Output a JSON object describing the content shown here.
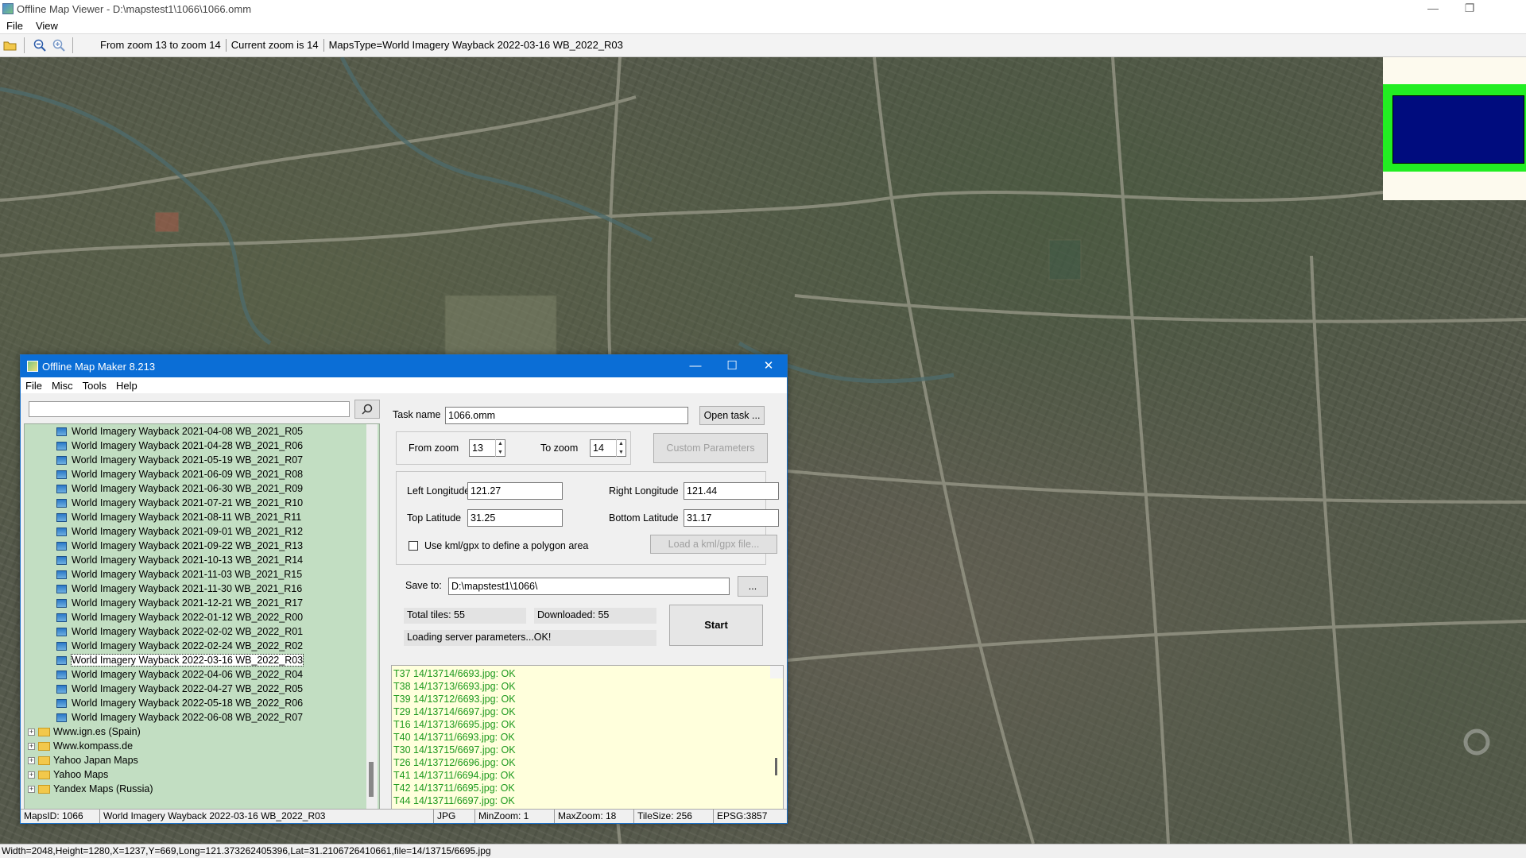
{
  "app": {
    "title": "Offline Map Viewer - D:\\mapstest1\\1066\\1066.omm",
    "minimize": "—",
    "restore": "❐",
    "menu": [
      "File",
      "View"
    ]
  },
  "toolbar": {
    "zoom_range": "From zoom 13 to zoom 14",
    "current_zoom": "Current zoom is 14",
    "maps_type": "MapsType=World Imagery Wayback 2022-03-16 WB_2022_R03"
  },
  "status_bar": "Width=2048,Height=1280,X=1237,Y=669,Long=121.373262405396,Lat=31.2106726410661,file=14/13715/6695.jpg",
  "colors": {
    "overview_bg": "#fdfaee",
    "overview_frame": "#22ee22",
    "overview_view": "#000c7e",
    "dialog_title": "#0b6ed6",
    "tree_bg": "#c2dec2",
    "log_bg": "#ffffdc",
    "log_text": "#1e9a1e"
  },
  "dialog": {
    "title": "Offline Map Maker 8.213",
    "controls": [
      "—",
      "☐",
      "✕"
    ],
    "menu": [
      "File",
      "Misc",
      "Tools",
      "Help"
    ],
    "search_placeholder": "",
    "tree_items": [
      "World Imagery Wayback 2021-04-08 WB_2021_R05",
      "World Imagery Wayback 2021-04-28 WB_2021_R06",
      "World Imagery Wayback 2021-05-19 WB_2021_R07",
      "World Imagery Wayback 2021-06-09 WB_2021_R08",
      "World Imagery Wayback 2021-06-30 WB_2021_R09",
      "World Imagery Wayback 2021-07-21 WB_2021_R10",
      "World Imagery Wayback 2021-08-11 WB_2021_R11",
      "World Imagery Wayback 2021-09-01 WB_2021_R12",
      "World Imagery Wayback 2021-09-22 WB_2021_R13",
      "World Imagery Wayback 2021-10-13 WB_2021_R14",
      "World Imagery Wayback 2021-11-03 WB_2021_R15",
      "World Imagery Wayback 2021-11-30 WB_2021_R16",
      "World Imagery Wayback 2021-12-21 WB_2021_R17",
      "World Imagery Wayback 2022-01-12 WB_2022_R00",
      "World Imagery Wayback 2022-02-02 WB_2022_R01",
      "World Imagery Wayback 2022-02-24 WB_2022_R02",
      "World Imagery Wayback 2022-03-16 WB_2022_R03",
      "World Imagery Wayback 2022-04-06 WB_2022_R04",
      "World Imagery Wayback 2022-04-27 WB_2022_R05",
      "World Imagery Wayback 2022-05-18 WB_2022_R06",
      "World Imagery Wayback 2022-06-08 WB_2022_R07"
    ],
    "selected_item": "World Imagery Wayback 2022-03-16 WB_2022_R03",
    "tree_folders": [
      "Www.ign.es (Spain)",
      "Www.kompass.de",
      "Yahoo Japan Maps",
      "Yahoo Maps",
      "Yandex Maps (Russia)"
    ],
    "task_name_label": "Task name",
    "task_name": "1066.omm",
    "open_task": "Open task ...",
    "from_zoom_label": "From zoom",
    "from_zoom": "13",
    "to_zoom_label": "To zoom",
    "to_zoom": "14",
    "custom_params": "Custom Parameters",
    "left_lon_label": "Left Longitude",
    "left_lon": "121.27",
    "right_lon_label": "Right Longitude",
    "right_lon": "121.44",
    "top_lat_label": "Top Latitude",
    "top_lat": "31.25",
    "bottom_lat_label": "Bottom Latitude",
    "bottom_lat": "31.17",
    "kml_label": "Use kml/gpx to define a polygon area",
    "kml_checked": false,
    "load_kml": "Load a kml/gpx file...",
    "save_to_label": "Save to:",
    "save_to": "D:\\mapstest1\\1066\\",
    "browse": "...",
    "total_tiles": "Total tiles: 55",
    "downloaded": "Downloaded: 55",
    "start": "Start",
    "server_status": "Loading server parameters...OK!",
    "log": [
      "T37 14/13714/6693.jpg: OK",
      "T38 14/13713/6693.jpg: OK",
      "T39 14/13712/6693.jpg: OK",
      "T29 14/13714/6697.jpg: OK",
      "T16 14/13713/6695.jpg: OK",
      "T40 14/13711/6693.jpg: OK",
      "T30 14/13715/6697.jpg: OK",
      "T26 14/13712/6696.jpg: OK",
      "T41 14/13711/6694.jpg: OK",
      "T42 14/13711/6695.jpg: OK",
      "T44 14/13711/6697.jpg: OK"
    ],
    "status": {
      "maps_id": "MapsID: 1066",
      "maps_name": "World Imagery Wayback 2022-03-16 WB_2022_R03",
      "format": "JPG",
      "min_zoom": "MinZoom: 1",
      "max_zoom": "MaxZoom: 18",
      "tile_size": "TileSize: 256",
      "epsg": "EPSG:3857"
    }
  }
}
